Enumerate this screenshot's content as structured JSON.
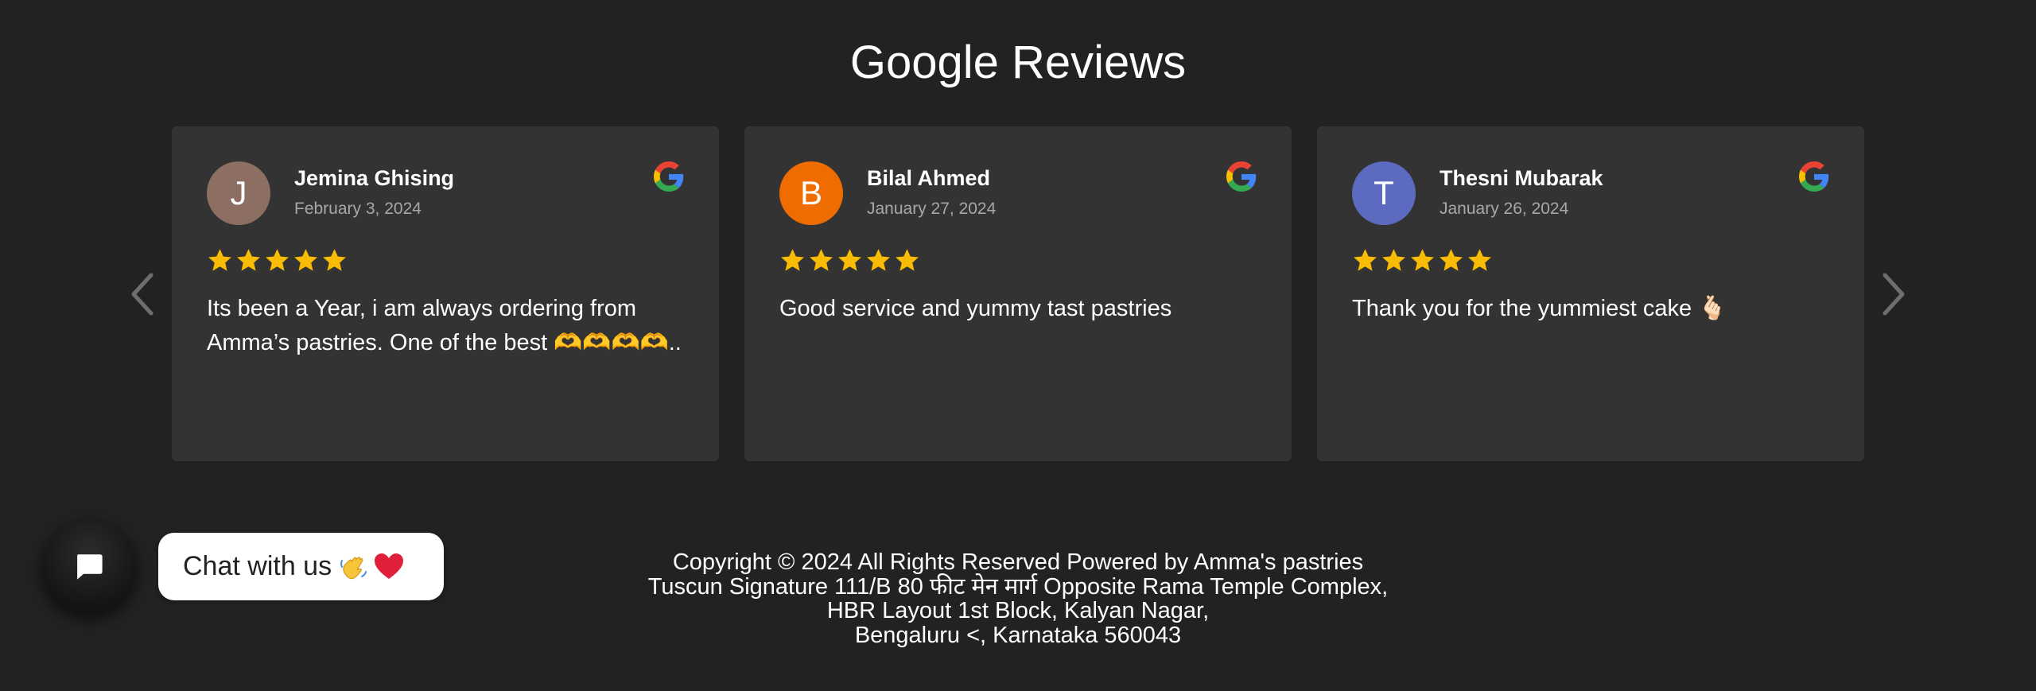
{
  "section": {
    "title": "Google Reviews"
  },
  "navigation": {
    "prev_icon": "chevron-left-icon",
    "next_icon": "chevron-right-icon"
  },
  "reviews": [
    {
      "initial": "J",
      "avatar_color": "#8d6e63",
      "name": "Jemina Ghising",
      "date": "February 3, 2024",
      "rating": 5,
      "text_line1": "Its been a Year, i am always ordering from",
      "text_line2": "Amma’s pastries. One of the best 🫶🫶🫶🫶.."
    },
    {
      "initial": "B",
      "avatar_color": "#ef6c00",
      "name": "Bilal Ahmed",
      "date": "January 27, 2024",
      "rating": 5,
      "text_line1": "Good service and yummy tast pastries",
      "text_line2": ""
    },
    {
      "initial": "T",
      "avatar_color": "#5c6bc0",
      "name": "Thesni Mubarak",
      "date": "January 26, 2024",
      "rating": 5,
      "text_line1": "Thank you for the yummiest cake 🫰🏻",
      "text_line2": ""
    }
  ],
  "chat": {
    "label": "Chat with us",
    "emoji": "👋❤️",
    "icon": "chat-icon"
  },
  "footer": {
    "line1": "Copyright © 2024 All Rights Reserved Powered by Amma's pastries",
    "line2": "Tuscun Signature 111/B 80 फीट मेन मार्ग Opposite Rama Temple Complex,",
    "line3": "HBR Layout 1st Block, Kalyan Nagar,",
    "line4": "Bengaluru <, Karnataka 560043"
  },
  "colors": {
    "background": "#222222",
    "card": "#333333",
    "star": "#f9bc05",
    "date": "#a7a7a7"
  }
}
